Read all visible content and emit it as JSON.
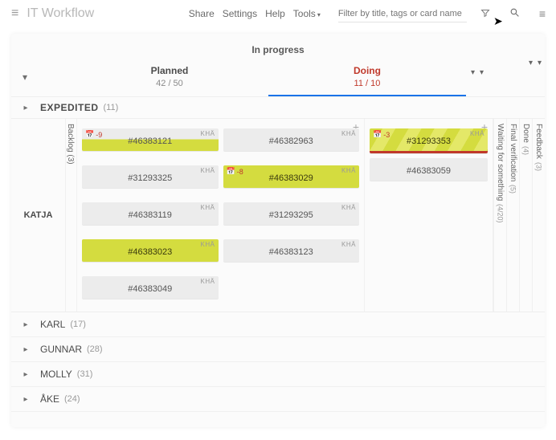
{
  "app": {
    "title": "IT Workflow"
  },
  "menu": {
    "share": "Share",
    "settings": "Settings",
    "help": "Help",
    "tools": "Tools"
  },
  "filter": {
    "placeholder": "Filter by title, tags or card name"
  },
  "stage": {
    "primary": "In progress"
  },
  "columns": {
    "planned": {
      "label": "Planned",
      "wip": "42 / 50"
    },
    "doing": {
      "label": "Doing",
      "wip": "11 / 10"
    }
  },
  "section_expedited": {
    "label": "EXPEDITED",
    "count": "(11)"
  },
  "backlog": {
    "label": "Backlog",
    "count": "(3)"
  },
  "swimlane_katja": {
    "name": "KATJA"
  },
  "cards": {
    "planned": [
      {
        "id": "#46383121",
        "assignee": "KHÄ",
        "badge": "-9",
        "variant": "partial"
      },
      {
        "id": "#46382963",
        "assignee": "KHÄ"
      },
      {
        "id": "#31293325",
        "assignee": "KHÄ"
      },
      {
        "id": "#46383029",
        "assignee": "KHÄ",
        "badge": "-8",
        "variant": "yellow"
      },
      {
        "id": "#46383119",
        "assignee": "KHÄ"
      },
      {
        "id": "#31293295",
        "assignee": "KHÄ"
      },
      {
        "id": "#46383023",
        "assignee": "KHÄ",
        "variant": "yellow"
      },
      {
        "id": "#46383123",
        "assignee": "KHÄ"
      },
      {
        "id": "#46383049",
        "assignee": "KHÄ"
      }
    ],
    "doing": [
      {
        "id": "#31293353",
        "assignee": "KHÄ",
        "badge": "-3",
        "variant": "stripe"
      },
      {
        "id": "#46383059"
      }
    ]
  },
  "right_columns": [
    {
      "label": "Waiting for something",
      "count": "(4/20)"
    },
    {
      "label": "Final verification",
      "count": "(5)"
    },
    {
      "label": "Done",
      "count": "(4)"
    },
    {
      "label": "Feedback",
      "count": "(3)"
    }
  ],
  "people": [
    {
      "name": "KARL",
      "count": "(17)"
    },
    {
      "name": "GUNNAR",
      "count": "(28)"
    },
    {
      "name": "MOLLY",
      "count": "(31)"
    },
    {
      "name": "ÅKE",
      "count": "(24)"
    }
  ],
  "glyph": {
    "plus": "+",
    "chev_down": "▾",
    "chev_right": "▸",
    "calendar": "📅",
    "chat": "💬"
  }
}
